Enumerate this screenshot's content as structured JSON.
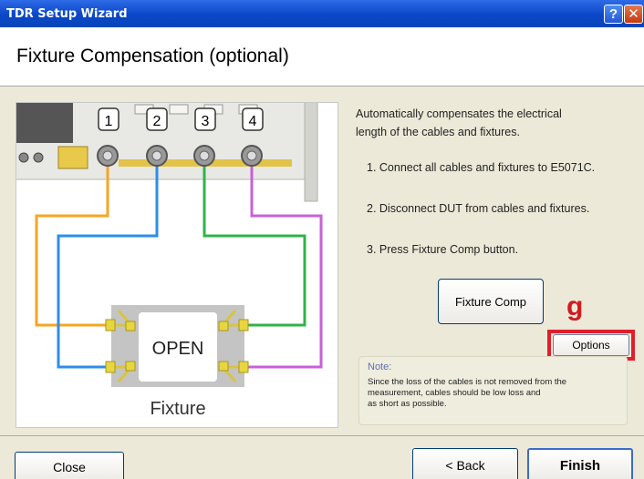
{
  "window": {
    "title": "TDR Setup Wizard",
    "help_glyph": "?",
    "close_glyph": "✕"
  },
  "header": {
    "title": "Fixture Compensation (optional)"
  },
  "diagram": {
    "port_labels": [
      "1",
      "2",
      "3",
      "4"
    ],
    "fixture_state": "OPEN",
    "fixture_label": "Fixture",
    "cable_colors": [
      "#F5A623",
      "#2D8DEB",
      "#2FB34A",
      "#C860D8"
    ]
  },
  "instructions": {
    "intro_line1": "Automatically compensates the electrical",
    "intro_line2": "length of the cables and fixtures.",
    "step1": "1. Connect all cables and fixtures to E5071C.",
    "step2": "2. Disconnect DUT from cables and fixtures.",
    "step3": "3. Press Fixture Comp button."
  },
  "buttons": {
    "fixture_comp": "Fixture Comp",
    "options": "Options",
    "close": "Close",
    "back": "< Back",
    "finish": "Finish"
  },
  "callout": {
    "letter": "g",
    "color": "#E21E2B"
  },
  "note": {
    "label": "Note:",
    "line1": "Since the loss of the cables is not removed from the",
    "line2": "measurement, cables should be low loss and",
    "line3": "as short as possible."
  }
}
